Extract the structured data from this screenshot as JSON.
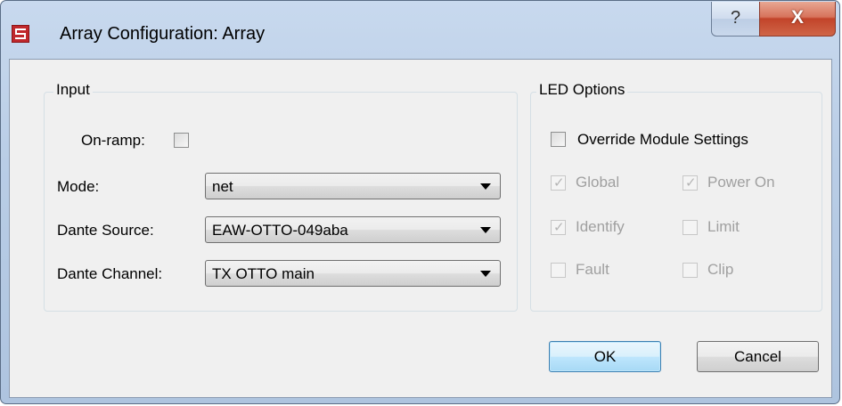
{
  "window": {
    "title": "Array Configuration: Array",
    "help_glyph": "?",
    "close_glyph": "X",
    "icon": "app-logo-icon"
  },
  "input_group": {
    "legend": "Input",
    "on_ramp_label": "On-ramp:",
    "on_ramp_checked": false,
    "mode_label": "Mode:",
    "mode_value": "net",
    "dante_source_label": "Dante Source:",
    "dante_source_value": "EAW-OTTO-049aba",
    "dante_channel_label": "Dante Channel:",
    "dante_channel_value": "TX OTTO main"
  },
  "led_group": {
    "legend": "LED Options",
    "override_label": "Override Module Settings",
    "override_checked": false,
    "options": [
      {
        "label": "Global",
        "checked": true,
        "enabled": false
      },
      {
        "label": "Power On",
        "checked": true,
        "enabled": false
      },
      {
        "label": "Identify",
        "checked": true,
        "enabled": false
      },
      {
        "label": "Limit",
        "checked": false,
        "enabled": false
      },
      {
        "label": "Fault",
        "checked": false,
        "enabled": false
      },
      {
        "label": "Clip",
        "checked": false,
        "enabled": false
      }
    ]
  },
  "buttons": {
    "ok_label": "OK",
    "cancel_label": "Cancel"
  }
}
